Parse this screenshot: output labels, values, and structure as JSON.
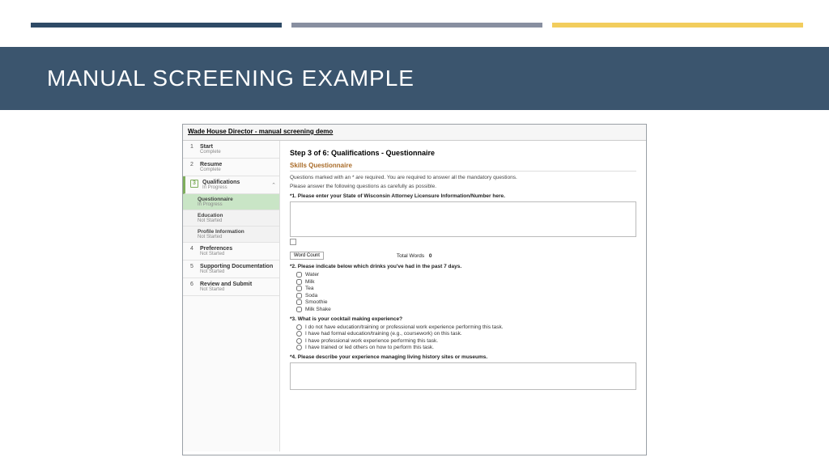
{
  "slide_title": "MANUAL SCREENING EXAMPLE",
  "app_title": "Wade House Director - manual screening demo",
  "sidebar": {
    "steps": [
      {
        "num": "1",
        "title": "Start",
        "status": "Complete"
      },
      {
        "num": "2",
        "title": "Resume",
        "status": "Complete"
      },
      {
        "num": "3",
        "title": "Qualifications",
        "status": "In Progress",
        "active": true
      },
      {
        "num": "4",
        "title": "Preferences",
        "status": "Not Started"
      },
      {
        "num": "5",
        "title": "Supporting Documentation",
        "status": "Not Started"
      },
      {
        "num": "6",
        "title": "Review and Submit",
        "status": "Not Started"
      }
    ],
    "substeps": [
      {
        "title": "Questionnaire",
        "status": "In Progress",
        "current": true
      },
      {
        "title": "Education",
        "status": "Not Started"
      },
      {
        "title": "Profile Information",
        "status": "Not Started"
      }
    ]
  },
  "main": {
    "step_title": "Step 3 of 6: Qualifications - Questionnaire",
    "subheader": "Skills Questionnaire",
    "intro1": "Questions marked with an * are required. You are required to answer all the mandatory questions.",
    "intro2": "Please answer the following questions as carefully as possible.",
    "q1": "*1.  Please enter your State of Wisconsin Attorney Licensure Information/Number here.",
    "word_count_btn": "Word Count",
    "total_words_label": "Total Words",
    "total_words_val": "0",
    "q2": "*2.  Please indicate below which drinks you've had in the past 7 days.",
    "q2_options": [
      "Water",
      "Milk",
      "Tea",
      "Soda",
      "Smoothie",
      "Milk Shake"
    ],
    "q3": "*3.  What is your cocktail making experience?",
    "q3_options": [
      "I do not have education/training or professional work experience performing this task.",
      "I have had formal education/training (e.g., coursework) on this task.",
      "I have professional work experience performing this task.",
      "I have trained or led others on how to perform this task."
    ],
    "q4": "*4.  Please describe your experience managing living history sites or museums."
  }
}
